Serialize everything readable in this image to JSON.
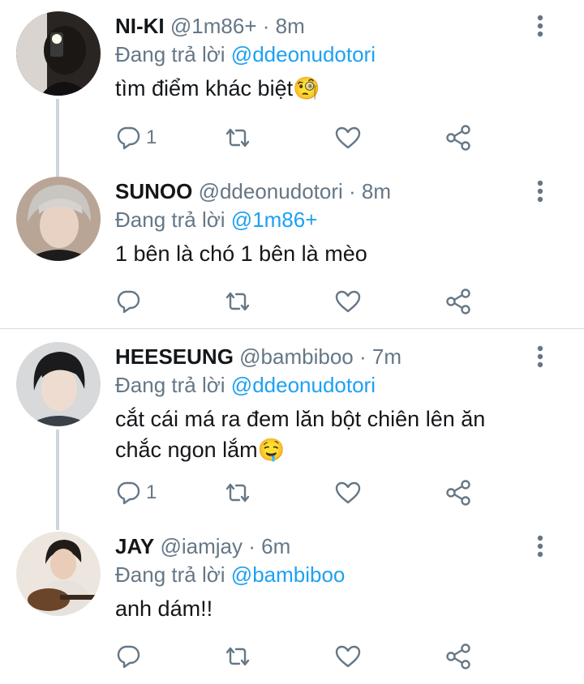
{
  "tweets": [
    {
      "name": "NI-KI",
      "handle": "@1m86+",
      "time": "8m",
      "reply_prefix": "Đang trả lời",
      "reply_to": "@ddeonudotori",
      "text": "tìm điểm khác biệt🧐",
      "reply_count": "1"
    },
    {
      "name": "SUNOO",
      "handle": "@ddeonudotori",
      "time": "8m",
      "reply_prefix": "Đang trả lời",
      "reply_to": "@1m86+",
      "text": "1 bên là chó 1 bên là mèo",
      "reply_count": ""
    },
    {
      "name": "HEESEUNG",
      "handle": "@bambiboo",
      "time": "7m",
      "reply_prefix": "Đang trả lời",
      "reply_to": "@ddeonudotori",
      "text": "cắt cái má ra đem lăn bột chiên lên ăn chắc ngon lắm🤤",
      "reply_count": "1"
    },
    {
      "name": "JAY",
      "handle": "@iamjay",
      "time": "6m",
      "reply_prefix": "Đang trả lời",
      "reply_to": "@bambiboo",
      "text": "anh dám!!",
      "reply_count": ""
    }
  ],
  "separator": "·",
  "colors": {
    "accent": "#1da1f2",
    "muted": "#657786",
    "text": "#14171a",
    "thread_line": "#ccd6dd"
  },
  "icons": [
    "reply-icon",
    "retweet-icon",
    "like-icon",
    "share-icon",
    "more-menu-icon"
  ]
}
